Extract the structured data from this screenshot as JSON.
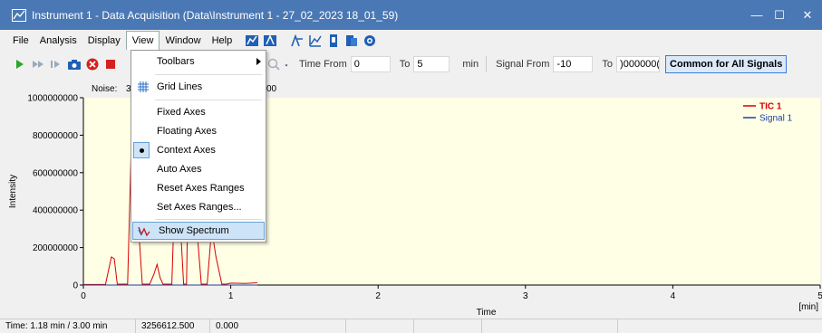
{
  "window": {
    "title": "Instrument 1 - Data Acquisition (Data\\Instrument 1 - 27_02_2023 18_01_59)",
    "minimize_glyph": "—",
    "maximize_glyph": "☐",
    "close_glyph": "✕"
  },
  "menubar": {
    "items": [
      "File",
      "Analysis",
      "Display",
      "View",
      "Window",
      "Help"
    ],
    "active": "View"
  },
  "toolbar": {
    "time_from_label": "Time From",
    "time_from_value": "0",
    "time_to_label": "To",
    "time_to_value": "5",
    "time_unit": "min",
    "signal_from_label": "Signal From",
    "signal_from_value": "-10",
    "signal_to_label": "To",
    "signal_to_value": ")000000(",
    "common_button": "Common for All Signals"
  },
  "view_menu": {
    "items": [
      {
        "label": "Toolbars",
        "submenu": true
      },
      {
        "label": "Grid Lines",
        "icon": "grid-icon"
      },
      {
        "label": "Fixed Axes"
      },
      {
        "label": "Floating Axes"
      },
      {
        "label": "Context Axes",
        "checked": true
      },
      {
        "label": "Auto Axes"
      },
      {
        "label": "Reset Axes Ranges"
      },
      {
        "label": "Set Axes Ranges..."
      },
      {
        "label": "Show Spectrum",
        "icon": "spectrum-icon",
        "highlighted": true
      }
    ]
  },
  "chart_data": {
    "type": "line",
    "noise_label": "Noise:",
    "noise_value_partial_1": "3",
    "noise_value_partial_2": "00",
    "ylabel": "Intensity",
    "xlabel": "Time",
    "x_unit": "[min]",
    "xlim": [
      0,
      5
    ],
    "ylim": [
      0,
      1000000000
    ],
    "x_ticks": [
      "0",
      "1",
      "2",
      "3",
      "4",
      "5"
    ],
    "y_ticks": [
      "0",
      "200000000",
      "400000000",
      "600000000",
      "800000000",
      "1000000000"
    ],
    "legend": [
      {
        "name": "TIC 1",
        "color": "#d40000"
      },
      {
        "name": "Signal 1",
        "color": "#1f3f9f"
      }
    ],
    "legend_position": "top-right",
    "background": "#ffffe6",
    "series": [
      {
        "name": "TIC 1",
        "color": "#d40000",
        "x": [
          0,
          0.15,
          0.19,
          0.21,
          0.23,
          0.3,
          0.33,
          0.35,
          0.4,
          0.45,
          0.48,
          0.5,
          0.52,
          0.54,
          0.56,
          0.6,
          0.64,
          0.66,
          0.68,
          0.7,
          0.72,
          0.76,
          0.8,
          0.84,
          0.87,
          0.9,
          0.94,
          0.97,
          1.0,
          1.1,
          1.18
        ],
        "y": [
          3000000,
          3000000,
          150000000,
          140000000,
          5000000,
          5000000,
          900000000,
          600000000,
          5000000,
          5000000,
          60000000,
          110000000,
          40000000,
          5000000,
          5000000,
          5000000,
          1000000000,
          300000000,
          5000000,
          5000000,
          1000000000,
          400000000,
          5000000,
          5000000,
          300000000,
          150000000,
          5000000,
          5000000,
          10000000,
          8000000,
          12000000
        ]
      },
      {
        "name": "Signal 1",
        "color": "#1f3f9f",
        "x": [
          0,
          1.18
        ],
        "y": [
          0,
          0
        ]
      }
    ]
  },
  "statusbar": {
    "time": "Time: 1.18 min / 3.00 min",
    "value": "3256612.500",
    "value2": "0.000"
  }
}
